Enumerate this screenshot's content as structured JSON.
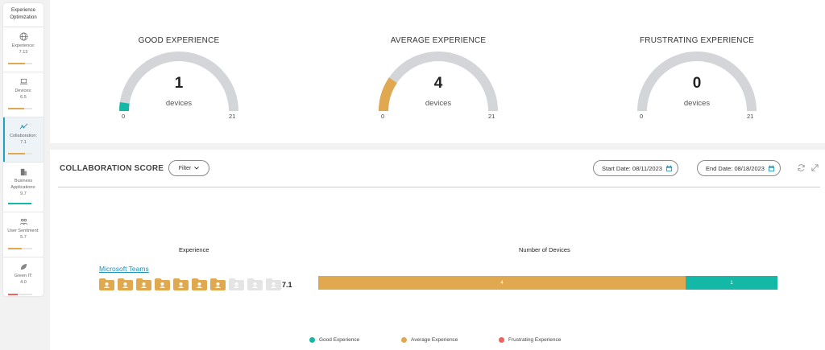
{
  "colors": {
    "good": "#14b8a6",
    "average": "#e0a84f",
    "frustrating": "#f0625e",
    "gauge_track": "#d3d5d9",
    "link": "#1a8fb6",
    "active_accent": "#1da1c4"
  },
  "sidebar": {
    "title": "Experience Optimization",
    "items": [
      {
        "icon": "globe-icon",
        "label": "Experience:",
        "value": "7.13",
        "fraction": 0.713,
        "color": "#e0a84f"
      },
      {
        "icon": "laptop-icon",
        "label": "Devices:",
        "value": "6.5",
        "fraction": 0.65,
        "color": "#e0a84f"
      },
      {
        "icon": "trend-line-icon",
        "label": "Collaboration:",
        "value": "7.1",
        "fraction": 0.71,
        "color": "#e0a84f",
        "active": true
      },
      {
        "icon": "building-icon",
        "label": "Business Applications:",
        "value": "9.7",
        "fraction": 0.97,
        "color": "#14b8a6"
      },
      {
        "icon": "users-icon",
        "label": "User Sentiment:",
        "value": "5.7",
        "fraction": 0.57,
        "color": "#e0a84f"
      },
      {
        "icon": "leaf-icon",
        "label": "Green IT:",
        "value": "4.0",
        "fraction": 0.4,
        "color": "#f0625e"
      }
    ]
  },
  "gauges": [
    {
      "title": "GOOD EXPERIENCE",
      "value": 1,
      "value_label": "1",
      "unit": "devices",
      "min": "0",
      "max": "21",
      "color": "#14b8a6"
    },
    {
      "title": "AVERAGE EXPERIENCE",
      "value": 4,
      "value_label": "4",
      "unit": "devices",
      "min": "0",
      "max": "21",
      "color": "#e0a84f"
    },
    {
      "title": "FRUSTRATING EXPERIENCE",
      "value": 0,
      "value_label": "0",
      "unit": "devices",
      "min": "0",
      "max": "21",
      "color": "#f0625e"
    }
  ],
  "score": {
    "title": "COLLABORATION SCORE",
    "filter_label": "Filter",
    "start_date": "Start Date: 08/11/2023",
    "end_date": "End Date: 08/18/2023",
    "experience_header": "Experience",
    "devices_header": "Number of Devices",
    "app": {
      "name": "Microsoft Teams",
      "score": "7.1",
      "filled_icons": 7,
      "total_icons": 10,
      "segments": [
        {
          "label": "4",
          "value": 4,
          "color": "#e0a84f"
        },
        {
          "label": "1",
          "value": 1,
          "color": "#14b8a6"
        }
      ]
    },
    "legend": [
      {
        "label": "Good Experience",
        "color": "#14b8a6"
      },
      {
        "label": "Average Experience",
        "color": "#e0a84f"
      },
      {
        "label": "Frustrating Experience",
        "color": "#f0625e"
      }
    ]
  }
}
